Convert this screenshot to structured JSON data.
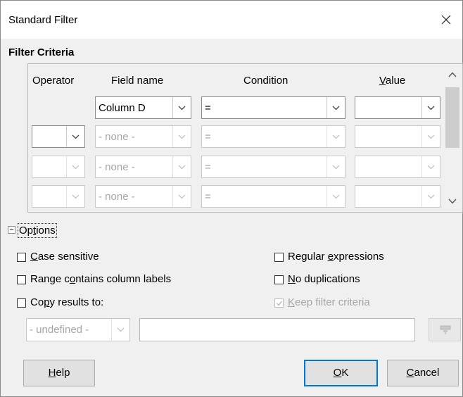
{
  "dialog": {
    "title": "Standard Filter",
    "close_symbol": "✕"
  },
  "criteria": {
    "section_title": "Filter Criteria",
    "headers": {
      "operator": "Operator",
      "field_name": "Field name",
      "condition": "Condition",
      "value": "Value"
    },
    "rows": [
      {
        "operator": "",
        "field": "Column D",
        "condition": "=",
        "value": "",
        "enabled": true,
        "operator_visible": false
      },
      {
        "operator": "",
        "field": "- none -",
        "condition": "=",
        "value": "",
        "enabled": false,
        "operator_visible": true
      },
      {
        "operator": "",
        "field": "- none -",
        "condition": "=",
        "value": "",
        "enabled": false,
        "operator_visible": true
      },
      {
        "operator": "",
        "field": "- none -",
        "condition": "=",
        "value": "",
        "enabled": false,
        "operator_visible": true
      }
    ]
  },
  "options": {
    "toggle_label": "Options",
    "expanded": true,
    "case_sensitive": {
      "label": "Case sensitive",
      "checked": false
    },
    "regular_expressions": {
      "label": "Regular expressions",
      "checked": false
    },
    "range_contains_labels": {
      "label": "Range contains column labels",
      "checked": false
    },
    "no_duplications": {
      "label": "No duplications",
      "checked": false
    },
    "copy_results_to": {
      "label": "Copy results to:",
      "checked": false
    },
    "keep_filter_criteria": {
      "label": "Keep filter criteria",
      "checked": true,
      "enabled": false
    },
    "copy_target": {
      "value": "- undefined -"
    },
    "copy_target_text": ""
  },
  "buttons": {
    "help": "Help",
    "ok": "OK",
    "cancel": "Cancel"
  },
  "colors": {
    "accent": "#0078d7",
    "disabled_text": "#a6a6a6"
  }
}
